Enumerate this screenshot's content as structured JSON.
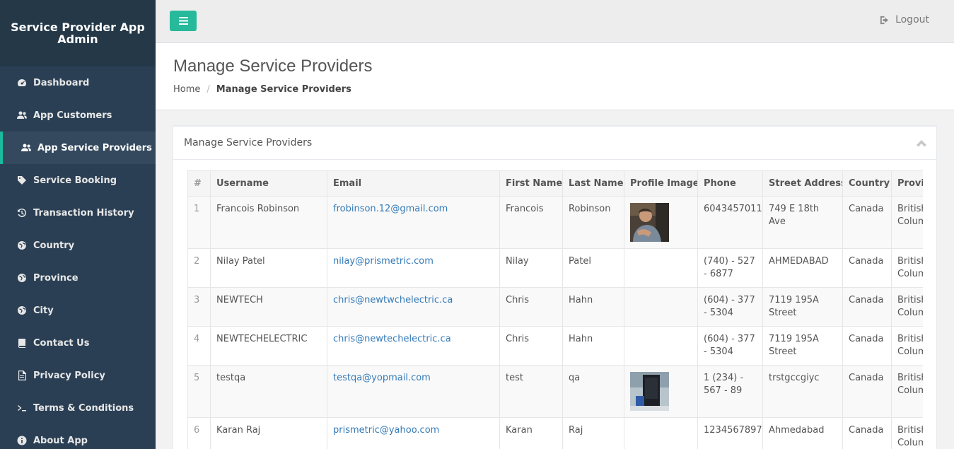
{
  "sidebar": {
    "brand": "Service Provider App Admin",
    "items": [
      {
        "label": "Dashboard",
        "icon": "dashboard-icon"
      },
      {
        "label": "App Customers",
        "icon": "users-icon"
      },
      {
        "label": "App Service Providers",
        "icon": "users-icon",
        "active": true
      },
      {
        "label": "Service Booking",
        "icon": "tag-icon"
      },
      {
        "label": "Transaction History",
        "icon": "history-icon"
      },
      {
        "label": "Country",
        "icon": "globe-icon"
      },
      {
        "label": "Province",
        "icon": "globe-icon"
      },
      {
        "label": "City",
        "icon": "globe-icon"
      },
      {
        "label": "Contact Us",
        "icon": "book-icon"
      },
      {
        "label": "Privacy Policy",
        "icon": "file-icon"
      },
      {
        "label": "Terms & Conditions",
        "icon": "terminal-icon"
      },
      {
        "label": "About App",
        "icon": "info-icon"
      }
    ]
  },
  "topbar": {
    "logout_label": "Logout"
  },
  "header": {
    "title": "Manage Service Providers",
    "breadcrumb": {
      "home": "Home",
      "current": "Manage Service Providers"
    }
  },
  "panel": {
    "title": "Manage Service Providers"
  },
  "table": {
    "columns": [
      "#",
      "Username",
      "Email",
      "First Name",
      "Last Name",
      "Profile Image",
      "Phone",
      "Street Address",
      "Country",
      "Province"
    ],
    "rows": [
      {
        "num": "1",
        "username": "Francois Robinson",
        "email": "frobinson.12@gmail.com",
        "first": "Francois",
        "last": "Robinson",
        "image": "person",
        "phone": "6043457011",
        "street": "749 E 18th Ave",
        "country": "Canada",
        "province": "British Columbia"
      },
      {
        "num": "2",
        "username": "Nilay Patel",
        "email": "nilay@prismetric.com",
        "first": "Nilay",
        "last": "Patel",
        "image": "",
        "phone": "(740) - 527 - 6877",
        "street": "AHMEDABAD",
        "country": "Canada",
        "province": "British Columbia"
      },
      {
        "num": "3",
        "username": "NEWTECH",
        "email": "chris@newtwchelectric.ca",
        "first": "Chris",
        "last": "Hahn",
        "image": "",
        "phone": "(604) - 377 - 5304",
        "street": "7119 195A Street",
        "country": "Canada",
        "province": "British Columbia"
      },
      {
        "num": "4",
        "username": "NEWTECHELECTRIC",
        "email": "chris@newtechelectric.ca",
        "first": "Chris",
        "last": "Hahn",
        "image": "",
        "phone": "(604) - 377 - 5304",
        "street": "7119 195A Street",
        "country": "Canada",
        "province": "British Columbia"
      },
      {
        "num": "5",
        "username": "testqa",
        "email": "testqa@yopmail.com",
        "first": "test",
        "last": "qa",
        "image": "device",
        "phone": "1 (234) - 567 - 89",
        "street": "trstgccgiyc",
        "country": "Canada",
        "province": "British Columbia"
      },
      {
        "num": "6",
        "username": "Karan Raj",
        "email": "prismetric@yahoo.com",
        "first": "Karan",
        "last": "Raj",
        "image": "",
        "phone": "1234567897",
        "street": "Ahmedabad",
        "country": "Canada",
        "province": "British Columbia"
      }
    ]
  }
}
